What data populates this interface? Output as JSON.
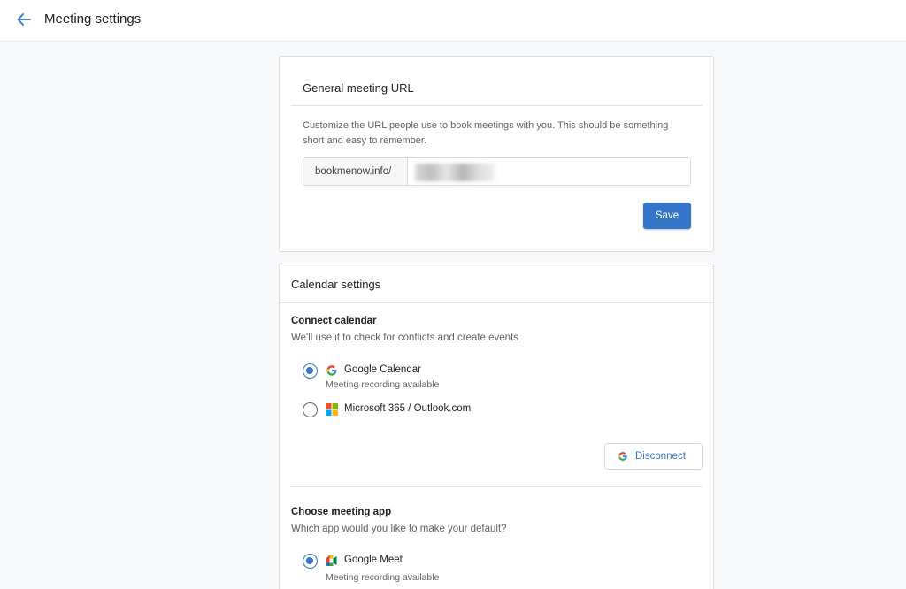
{
  "header": {
    "title": "Meeting settings"
  },
  "url_card": {
    "heading": "General meeting URL",
    "description": "Customize the URL people use to book meetings with you. This should be something short and easy to remember.",
    "prefix": "bookmenow.info/",
    "value": "",
    "save_label": "Save"
  },
  "calendar_card": {
    "heading": "Calendar settings",
    "connect": {
      "title": "Connect calendar",
      "subtitle": "We'll use it to check for conflicts and create events",
      "options": [
        {
          "label": "Google Calendar",
          "sub": "Meeting recording available",
          "selected": true,
          "icon": "google-icon"
        },
        {
          "label": "Microsoft 365 / Outlook.com",
          "sub": "",
          "selected": false,
          "icon": "microsoft-icon"
        }
      ],
      "disconnect_label": "Disconnect"
    },
    "meeting_app": {
      "title": "Choose meeting app",
      "subtitle": "Which app would you like to make your default?",
      "options": [
        {
          "label": "Google Meet",
          "sub": "Meeting recording available",
          "selected": true,
          "icon": "google-meet-icon"
        }
      ]
    }
  },
  "colors": {
    "accent": "#3475c9",
    "background": "#f7f8fa"
  }
}
